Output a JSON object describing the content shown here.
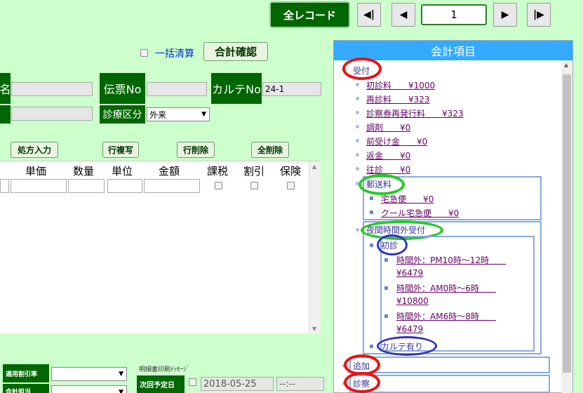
{
  "nav": {
    "all_records": "全レコード",
    "first": "◀|",
    "prev": "◀",
    "page": "1",
    "next": "▶",
    "last": "|▶"
  },
  "settle": {
    "bulk_label": "一括清算",
    "confirm_button": "合計確認"
  },
  "form": {
    "name_label": "名",
    "slip_label": "伝票No",
    "karte_label": "カルテNo",
    "karte_value": "24-1",
    "dept_label": "診療区分",
    "dept_value": "外来"
  },
  "buttons": {
    "prescription": "処方入力",
    "copy_row": "行複写",
    "delete_row": "行削除",
    "delete_all": "全削除"
  },
  "grid": {
    "headers": [
      "単価",
      "数量",
      "単位",
      "金額",
      "課税",
      "割引",
      "保険"
    ]
  },
  "bottom": {
    "discount_label": "適用割引率",
    "staff_label": "会計担当",
    "print_msg_label": "明細書印刷ﾒｯｾｰｼﾞ",
    "next_date_label": "次回予定日",
    "next_date_value": "2018-05-25",
    "next_time_value": "--:--"
  },
  "panel": {
    "title": "会計項目",
    "reception": "受付",
    "reception_items": [
      "初診料　　¥1000",
      "再診料　　¥323",
      "診察券再発行料　　¥323",
      "調剤　　¥0",
      "前受け金　　¥0",
      "返金　　¥0",
      "往診　　¥0"
    ],
    "postage": "郵送料",
    "postage_items": [
      "宅急便　　¥0",
      "クール宅急便　　¥0"
    ],
    "night": "夜間時間外受付",
    "first_visit": "初診",
    "night_items": [
      {
        "line1": "時間外：PM10時～12時　　",
        "line2": "¥6479"
      },
      {
        "line1": "時間外：AM0時～6時　　",
        "line2": "¥10800"
      },
      {
        "line1": "時間外：AM6時～8時　　",
        "line2": "¥6479"
      }
    ],
    "karte_present": "カルテ有り",
    "add": "追加",
    "exam": "診察"
  }
}
